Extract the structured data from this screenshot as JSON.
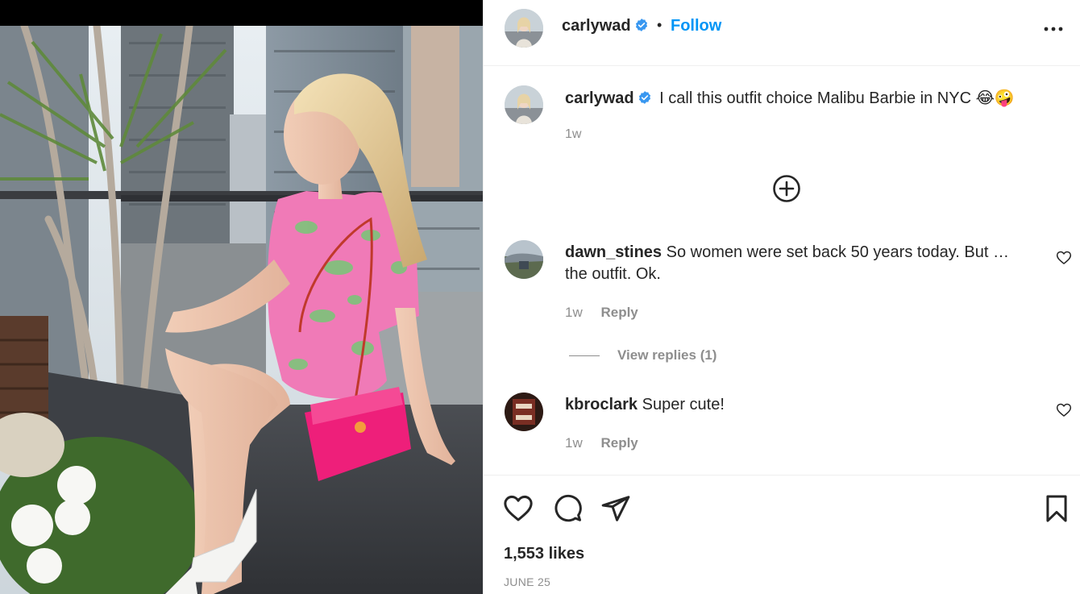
{
  "post": {
    "author": "carlywad",
    "follow_label": "Follow",
    "separator": "•",
    "photo_alt": "Woman in pink and green dress holding a pink handbag on a rooftop in NYC"
  },
  "caption": {
    "username": "carlywad",
    "text": "I call this outfit choice Malibu Barbie in NYC 😂🤪",
    "time": "1w"
  },
  "comments": [
    {
      "username": "dawn_stines",
      "text": "So women were set back 50 years today. But … the outfit. Ok.",
      "time": "1w",
      "reply_label": "Reply",
      "view_replies_label": "View replies (1)"
    },
    {
      "username": "kbroclark",
      "text": "Super cute!",
      "time": "1w",
      "reply_label": "Reply"
    }
  ],
  "stats": {
    "likes": "1,553 likes",
    "date": "JUNE 25"
  },
  "icons": {
    "verified": "verified-badge-icon",
    "more": "more-options-icon",
    "load_more": "plus-circle-icon",
    "like": "heart-icon",
    "comment": "comment-bubble-icon",
    "share": "paper-plane-icon",
    "save": "bookmark-icon"
  },
  "colors": {
    "link_blue": "#0095f6",
    "verified_blue": "#3897f0",
    "muted": "#8e8e8e",
    "text": "#262626",
    "border": "#efefef"
  }
}
